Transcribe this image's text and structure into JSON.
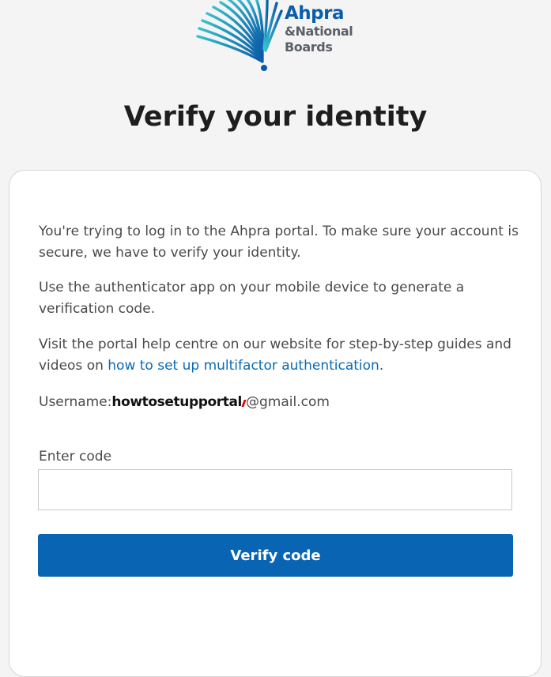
{
  "logo": {
    "brand": "Ahpra",
    "subtitle_line1": "&National",
    "subtitle_line2": "Boards",
    "colors": {
      "brand_blue": "#0a5eab",
      "teal": "#29b5c7",
      "sub_grey": "#5b5f68"
    }
  },
  "page_title": "Verify your identity",
  "card": {
    "intro": "You're trying to log in to the Ahpra portal. To make sure your account is secure, we have to verify your identity.",
    "instructions": "Use the authenticator app on your mobile device to generate a verification code.",
    "help_prefix": "Visit the portal help centre on our website for step-by-step guides and videos on ",
    "help_link": "how to set up multifactor authentication",
    "help_suffix": ".",
    "username_label": "Username:",
    "username_value": "howtosetupportal",
    "username_domain": "@gmail.com",
    "code_label": "Enter code",
    "code_value": "",
    "code_placeholder": "",
    "submit_label": "Verify code"
  },
  "colors": {
    "primary_button": "#0a64b4",
    "link": "#0a6ab6",
    "background": "#f4f4f4"
  }
}
